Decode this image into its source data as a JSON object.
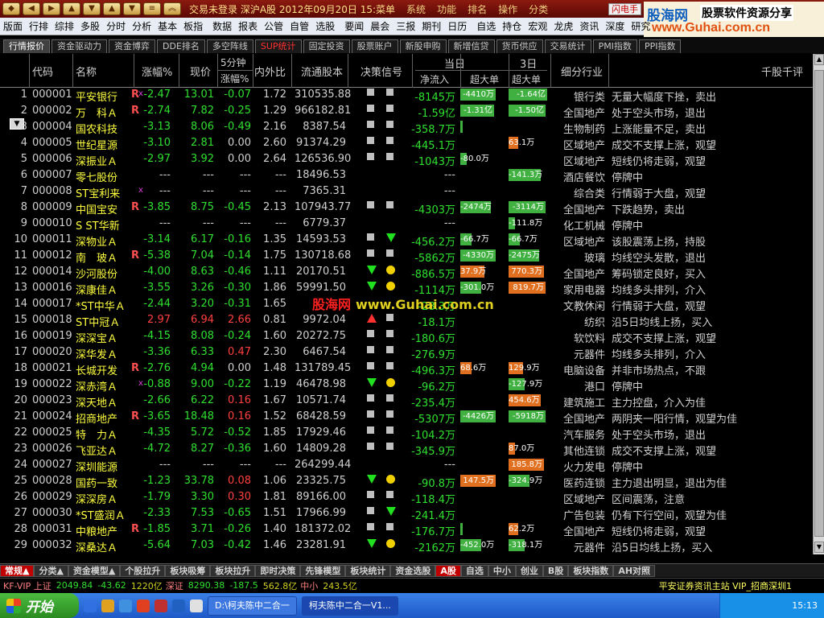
{
  "title_bar": {
    "text": "交易未登录  深沪A股  2012年09月20日 15:菜单",
    "menus": [
      "系统",
      "功能",
      "排名",
      "操作",
      "分类"
    ],
    "flash_button": "闪电手"
  },
  "brand": {
    "name": "股海网",
    "slogan": "股票软件资源分享",
    "url": "www.Guhai.com.cn"
  },
  "menubar": [
    "版面",
    "行排",
    "综排",
    "多股",
    "分时",
    "分析",
    "基本",
    "板指",
    "数据",
    "报表",
    "公管",
    "自管",
    "选股",
    "要闻",
    "晨会",
    "三报",
    "期刊",
    "日历",
    "自选",
    "持仓",
    "宏观",
    "龙虎",
    "资讯",
    "深度",
    "研究"
  ],
  "top_tabs": [
    "行情报价",
    "资金驱动力",
    "资金博弈",
    "DDE排名",
    "多空阵线",
    "SUP统计",
    "固定投资",
    "股票账户",
    "新股申购",
    "新增信贷",
    "货币供应",
    "交易统计",
    "PMI指数",
    "PPI指数"
  ],
  "header": {
    "code": "代码",
    "name": "名称",
    "chg": "涨幅%",
    "price": "现价",
    "m5a": "5分钟",
    "m5b": "涨幅%",
    "vr": "内外比",
    "cap": "流通股本",
    "signal": "决策信号",
    "day": "当日",
    "net": "净流入",
    "super": "超大单",
    "day3": "3日",
    "super3": "超大单",
    "industry": "细分行业",
    "comment": "千股千评"
  },
  "rows": [
    {
      "no": "1",
      "code": "000001",
      "name": "平安银行",
      "r": "R",
      "x": "x",
      "chg": "-2.47",
      "price": "13.01",
      "m5": "-0.07",
      "vr": "1.72",
      "cap": "310535.88",
      "s1": "sq",
      "s2": "sq",
      "flow": "-8145万",
      "b1": "-4410万",
      "b1t": "g",
      "b1w": 44,
      "b2": "-1.64亿",
      "b2t": "g",
      "b2w": 48,
      "ind": "银行类",
      "com": "无量大幅度下挫，卖出"
    },
    {
      "no": "2",
      "code": "000002",
      "name": "万　科Ａ",
      "r": "R",
      "x": "",
      "chg": "-2.74",
      "price": "7.82",
      "m5": "-0.25",
      "vr": "1.29",
      "cap": "966182.81",
      "s1": "sq",
      "s2": "sq",
      "flow": "-1.59亿",
      "b1": "-1.31亿",
      "b1t": "g",
      "b1w": 42,
      "b2": "-1.50亿",
      "b2t": "g",
      "b2w": 46,
      "ind": "全国地产",
      "com": "处于空头市场，退出"
    },
    {
      "no": "3",
      "code": "000004",
      "name": "国农科技",
      "r": "",
      "x": "",
      "chg": "-3.13",
      "price": "8.06",
      "m5": "-0.49",
      "vr": "2.16",
      "cap": "8387.54",
      "s1": "sq",
      "s2": "sq",
      "flow": "-358.7万",
      "b1": "",
      "b1t": "g",
      "b1w": 3,
      "b2": "",
      "b2t": "",
      "b2w": 0,
      "ind": "生物制药",
      "com": "上涨能量不足，卖出"
    },
    {
      "no": "4",
      "code": "000005",
      "name": "世纪星源",
      "r": "",
      "x": "",
      "chg": "-3.10",
      "price": "2.81",
      "m5": "0.00",
      "vr": "2.60",
      "cap": "91374.29",
      "s1": "sq",
      "s2": "sq",
      "flow": "-445.1万",
      "b1": "",
      "b1t": "",
      "b1w": 0,
      "b2": "63.1万",
      "b2t": "o",
      "b2w": 12,
      "ind": "区域地产",
      "com": "成交不支撑上涨，观望"
    },
    {
      "no": "5",
      "code": "000006",
      "name": "深振业Ａ",
      "r": "",
      "x": "",
      "chg": "-2.97",
      "price": "3.92",
      "m5": "0.00",
      "vr": "2.64",
      "cap": "126536.90",
      "s1": "sq",
      "s2": "sq",
      "flow": "-1043万",
      "b1": "-80.0万",
      "b1t": "g",
      "b1w": 8,
      "b2": "",
      "b2t": "",
      "b2w": 0,
      "ind": "区域地产",
      "com": "短线仍将走弱，观望"
    },
    {
      "no": "6",
      "code": "000007",
      "name": "零七股份",
      "r": "",
      "x": "",
      "chg": "---",
      "price": "---",
      "m5": "---",
      "vr": "---",
      "cap": "18496.53",
      "s1": "",
      "s2": "",
      "flow": "---",
      "b1": "",
      "b1t": "",
      "b1w": 0,
      "b2": "-141.3万",
      "b2t": "g",
      "b2w": 40,
      "ind": "酒店餐饮",
      "com": "停牌中"
    },
    {
      "no": "7",
      "code": "000008",
      "name": "ST宝利来",
      "r": "",
      "x": "x",
      "chg": "---",
      "price": "---",
      "m5": "---",
      "vr": "---",
      "cap": "7365.31",
      "s1": "",
      "s2": "",
      "flow": "---",
      "b1": "",
      "b1t": "",
      "b1w": 0,
      "b2": "",
      "b2t": "",
      "b2w": 0,
      "ind": "综合类",
      "com": "行情弱于大盘，观望"
    },
    {
      "no": "8",
      "code": "000009",
      "name": "中国宝安",
      "r": "R",
      "x": "",
      "chg": "-3.85",
      "price": "8.75",
      "m5": "-0.45",
      "vr": "2.13",
      "cap": "107943.77",
      "s1": "sq",
      "s2": "sq",
      "flow": "-4303万",
      "b1": "-2474万",
      "b1t": "g",
      "b1w": 38,
      "b2": "-3114万",
      "b2t": "g",
      "b2w": 46,
      "ind": "全国地产",
      "com": "下跌趋势，卖出"
    },
    {
      "no": "9",
      "code": "000010",
      "name": "S ST华新",
      "r": "",
      "x": "",
      "chg": "---",
      "price": "---",
      "m5": "---",
      "vr": "---",
      "cap": "6779.37",
      "s1": "",
      "s2": "",
      "flow": "---",
      "b1": "",
      "b1t": "",
      "b1w": 0,
      "b2": "-111.8万",
      "b2t": "g",
      "b2w": 8,
      "ind": "化工机械",
      "com": "停牌中"
    },
    {
      "no": "10",
      "code": "000011",
      "name": "深物业Ａ",
      "r": "",
      "x": "",
      "chg": "-3.14",
      "price": "6.17",
      "m5": "-0.16",
      "vr": "1.35",
      "cap": "14593.53",
      "s1": "sq",
      "s2": "td",
      "flow": "-456.2万",
      "b1": "-66.7万",
      "b1t": "g",
      "b1w": 14,
      "b2": "-66.7万",
      "b2t": "g",
      "b2w": 14,
      "ind": "区域地产",
      "com": "该股震荡上扬，持股"
    },
    {
      "no": "11",
      "code": "000012",
      "name": "南　玻Ａ",
      "r": "R",
      "x": "",
      "chg": "-5.38",
      "price": "7.04",
      "m5": "-0.14",
      "vr": "1.75",
      "cap": "130718.68",
      "s1": "sq",
      "s2": "sq",
      "flow": "-5862万",
      "b1": "-4330万",
      "b1t": "g",
      "b1w": 44,
      "b2": "-2475万",
      "b2t": "g",
      "b2w": 38,
      "ind": "玻璃",
      "com": "均线空头发散，退出"
    },
    {
      "no": "12",
      "code": "000014",
      "name": "沙河股份",
      "r": "",
      "x": "",
      "chg": "-4.00",
      "price": "8.63",
      "m5": "-0.46",
      "vr": "1.11",
      "cap": "20170.51",
      "s1": "td",
      "s2": "ci",
      "flow": "-886.5万",
      "b1": "37.9万",
      "b1t": "o",
      "b1w": 30,
      "b2": "770.3万",
      "b2t": "o",
      "b2w": 44,
      "ind": "全国地产",
      "com": "筹码锁定良好，买入"
    },
    {
      "no": "13",
      "code": "000016",
      "name": "深康佳Ａ",
      "r": "",
      "x": "",
      "chg": "-3.55",
      "price": "3.26",
      "m5": "-0.30",
      "vr": "1.86",
      "cap": "59991.50",
      "s1": "td",
      "s2": "ci",
      "flow": "-1114万",
      "b1": "-301.0万",
      "b1t": "g",
      "b1w": 26,
      "b2": "819.7万",
      "b2t": "o",
      "b2w": 46,
      "ind": "家用电器",
      "com": "均线多头排列，介入"
    },
    {
      "no": "14",
      "code": "000017",
      "name": "*ST中华Ａ",
      "r": "",
      "x": "",
      "chg": "-2.44",
      "price": "3.20",
      "m5": "-0.31",
      "vr": "1.65",
      "cap": "",
      "s1": "",
      "s2": "",
      "flow": "-28.3万",
      "b1": "",
      "b1t": "",
      "b1w": 0,
      "b2": "",
      "b2t": "",
      "b2w": 0,
      "ind": "文教休闲",
      "com": "行情弱于大盘，观望"
    },
    {
      "no": "15",
      "code": "000018",
      "name": "ST中冠Ａ",
      "r": "",
      "x": "",
      "chg": "2.97",
      "price": "6.94",
      "m5": "2.66",
      "vr": "0.81",
      "cap": "9972.04",
      "s1": "tu",
      "s2": "sq",
      "flow": "-18.1万",
      "b1": "",
      "b1t": "",
      "b1w": 0,
      "b2": "",
      "b2t": "",
      "b2w": 0,
      "ind": "纺织",
      "com": "沿5日均线上扬，买入"
    },
    {
      "no": "16",
      "code": "000019",
      "name": "深深宝Ａ",
      "r": "",
      "x": "",
      "chg": "-4.15",
      "price": "8.08",
      "m5": "-0.24",
      "vr": "1.60",
      "cap": "20272.75",
      "s1": "sq",
      "s2": "sq",
      "flow": "-180.6万",
      "b1": "",
      "b1t": "",
      "b1w": 0,
      "b2": "",
      "b2t": "",
      "b2w": 0,
      "ind": "软饮料",
      "com": "成交不支撑上涨，观望"
    },
    {
      "no": "17",
      "code": "000020",
      "name": "深华发Ａ",
      "r": "",
      "x": "",
      "chg": "-3.36",
      "price": "6.33",
      "m5": "0.47",
      "vr": "2.30",
      "cap": "6467.54",
      "s1": "sq",
      "s2": "sq",
      "flow": "-276.9万",
      "b1": "",
      "b1t": "",
      "b1w": 0,
      "b2": "",
      "b2t": "",
      "b2w": 0,
      "ind": "元器件",
      "com": "均线多头排列，介入"
    },
    {
      "no": "18",
      "code": "000021",
      "name": "长城开发",
      "r": "R",
      "x": "",
      "chg": "-2.76",
      "price": "4.94",
      "m5": "0.00",
      "vr": "1.48",
      "cap": "131789.45",
      "s1": "sq",
      "s2": "sq",
      "flow": "-496.3万",
      "b1": "68.6万",
      "b1t": "o",
      "b1w": 14,
      "b2": "129.9万",
      "b2t": "o",
      "b2w": 18,
      "ind": "电脑设备",
      "com": "并非市场热点，不跟"
    },
    {
      "no": "19",
      "code": "000022",
      "name": "深赤湾Ａ",
      "r": "",
      "x": "x",
      "chg": "-0.88",
      "price": "9.00",
      "m5": "-0.22",
      "vr": "1.19",
      "cap": "46478.98",
      "s1": "td",
      "s2": "ci",
      "flow": "-96.2万",
      "b1": "",
      "b1t": "",
      "b1w": 0,
      "b2": "-127.9万",
      "b2t": "g",
      "b2w": 20,
      "ind": "港口",
      "com": "停牌中"
    },
    {
      "no": "20",
      "code": "000023",
      "name": "深天地Ａ",
      "r": "",
      "x": "",
      "chg": "-2.66",
      "price": "6.22",
      "m5": "0.16",
      "vr": "1.67",
      "cap": "10571.74",
      "s1": "sq",
      "s2": "sq",
      "flow": "-235.4万",
      "b1": "",
      "b1t": "",
      "b1w": 0,
      "b2": "454.6万",
      "b2t": "o",
      "b2w": 40,
      "ind": "建筑施工",
      "com": "主力控盘，介入为佳"
    },
    {
      "no": "21",
      "code": "000024",
      "name": "招商地产",
      "r": "R",
      "x": "",
      "chg": "-3.65",
      "price": "18.48",
      "m5": "0.16",
      "vr": "1.52",
      "cap": "68428.59",
      "s1": "sq",
      "s2": "sq",
      "flow": "-5307万",
      "b1": "-4426万",
      "b1t": "g",
      "b1w": 44,
      "b2": "-5918万",
      "b2t": "g",
      "b2w": 46,
      "ind": "全国地产",
      "com": "两阴夹一阳行情，观望为佳"
    },
    {
      "no": "22",
      "code": "000025",
      "name": "特　力Ａ",
      "r": "",
      "x": "",
      "chg": "-4.35",
      "price": "5.72",
      "m5": "-0.52",
      "vr": "1.85",
      "cap": "17929.46",
      "s1": "sq",
      "s2": "sq",
      "flow": "-104.2万",
      "b1": "",
      "b1t": "",
      "b1w": 0,
      "b2": "",
      "b2t": "",
      "b2w": 0,
      "ind": "汽车服务",
      "com": "处于空头市场，退出"
    },
    {
      "no": "23",
      "code": "000026",
      "name": "飞亚达Ａ",
      "r": "",
      "x": "",
      "chg": "-4.72",
      "price": "8.27",
      "m5": "-0.36",
      "vr": "1.60",
      "cap": "14809.28",
      "s1": "sq",
      "s2": "sq",
      "flow": "-345.9万",
      "b1": "",
      "b1t": "",
      "b1w": 0,
      "b2": "87.0万",
      "b2t": "o",
      "b2w": 8,
      "ind": "其他连锁",
      "com": "成交不支撑上涨，观望"
    },
    {
      "no": "24",
      "code": "000027",
      "name": "深圳能源",
      "r": "",
      "x": "",
      "chg": "---",
      "price": "---",
      "m5": "---",
      "vr": "---",
      "cap": "264299.44",
      "s1": "",
      "s2": "",
      "flow": "---",
      "b1": "",
      "b1t": "",
      "b1w": 0,
      "b2": "185.8万",
      "b2t": "o",
      "b2w": 44,
      "ind": "火力发电",
      "com": "停牌中"
    },
    {
      "no": "25",
      "code": "000028",
      "name": "国药一致",
      "r": "",
      "x": "",
      "chg": "-1.23",
      "price": "33.78",
      "m5": "0.08",
      "vr": "1.06",
      "cap": "23325.75",
      "s1": "td",
      "s2": "ci",
      "flow": "-90.8万",
      "b1": "147.5万",
      "b1t": "o",
      "b1w": 44,
      "b2": "-324.9万",
      "b2t": "g",
      "b2w": 26,
      "ind": "医药连锁",
      "com": "主力退出明显，退出为佳"
    },
    {
      "no": "26",
      "code": "000029",
      "name": "深深房Ａ",
      "r": "",
      "x": "",
      "chg": "-1.79",
      "price": "3.30",
      "m5": "0.30",
      "vr": "1.81",
      "cap": "89166.00",
      "s1": "sq",
      "s2": "sq",
      "flow": "-118.4万",
      "b1": "",
      "b1t": "",
      "b1w": 0,
      "b2": "",
      "b2t": "",
      "b2w": 0,
      "ind": "区域地产",
      "com": "区间震荡，注意"
    },
    {
      "no": "27",
      "code": "000030",
      "name": "*ST盛润Ａ",
      "r": "",
      "x": "",
      "chg": "-2.33",
      "price": "7.53",
      "m5": "-0.65",
      "vr": "1.51",
      "cap": "17966.99",
      "s1": "sq",
      "s2": "td",
      "flow": "-241.4万",
      "b1": "",
      "b1t": "",
      "b1w": 0,
      "b2": "",
      "b2t": "",
      "b2w": 0,
      "ind": "广告包装",
      "com": "仍有下行空间，观望为佳"
    },
    {
      "no": "28",
      "code": "000031",
      "name": "中粮地产",
      "r": "R",
      "x": "",
      "chg": "-1.85",
      "price": "3.71",
      "m5": "-0.26",
      "vr": "1.40",
      "cap": "181372.02",
      "s1": "sq",
      "s2": "sq",
      "flow": "-176.7万",
      "b1": "",
      "b1t": "g",
      "b1w": 3,
      "b2": "62.2万",
      "b2t": "o",
      "b2w": 12,
      "ind": "全国地产",
      "com": "短线仍将走弱，观望"
    },
    {
      "no": "29",
      "code": "000032",
      "name": "深桑达Ａ",
      "r": "",
      "x": "",
      "chg": "-5.64",
      "price": "7.03",
      "m5": "-0.42",
      "vr": "1.46",
      "cap": "23281.91",
      "s1": "td",
      "s2": "ci",
      "flow": "-2162万",
      "b1": "-452.0万",
      "b1t": "g",
      "b1w": 26,
      "b2": "-318.1万",
      "b2t": "g",
      "b2w": 20,
      "ind": "元器件",
      "com": "沿5日均线上扬，买入"
    }
  ],
  "watermark": {
    "cn": "股海网",
    "url": "www.Guhai.com.cn"
  },
  "bottom_tabs": [
    "常规▲",
    "分类▲",
    "资金模型▲",
    "个股拉升",
    "板块吸筹",
    "板块拉升",
    "即时决策",
    "先锋模型",
    "板块统计",
    "资金选股",
    "A股",
    "自选",
    "中小",
    "创业",
    "B股",
    "板块指数",
    "AH对照"
  ],
  "status": {
    "left": "KF-VIP 上证",
    "v1": "2049.84",
    "v2": "-43.62",
    "v3": "1220亿",
    "sz": "深证",
    "v4": "8290.38",
    "v5": "-187.5",
    "v6": "562.8亿",
    "mid": "中小",
    "v7": "243.5亿",
    "right": "平安证券资讯主站 VIP_招商深圳1"
  },
  "taskbar": {
    "start": "开始",
    "tasks": [
      "D:\\柯夫陈中二合一",
      "柯夫陈中二合一V1..."
    ],
    "time": "15:13"
  }
}
